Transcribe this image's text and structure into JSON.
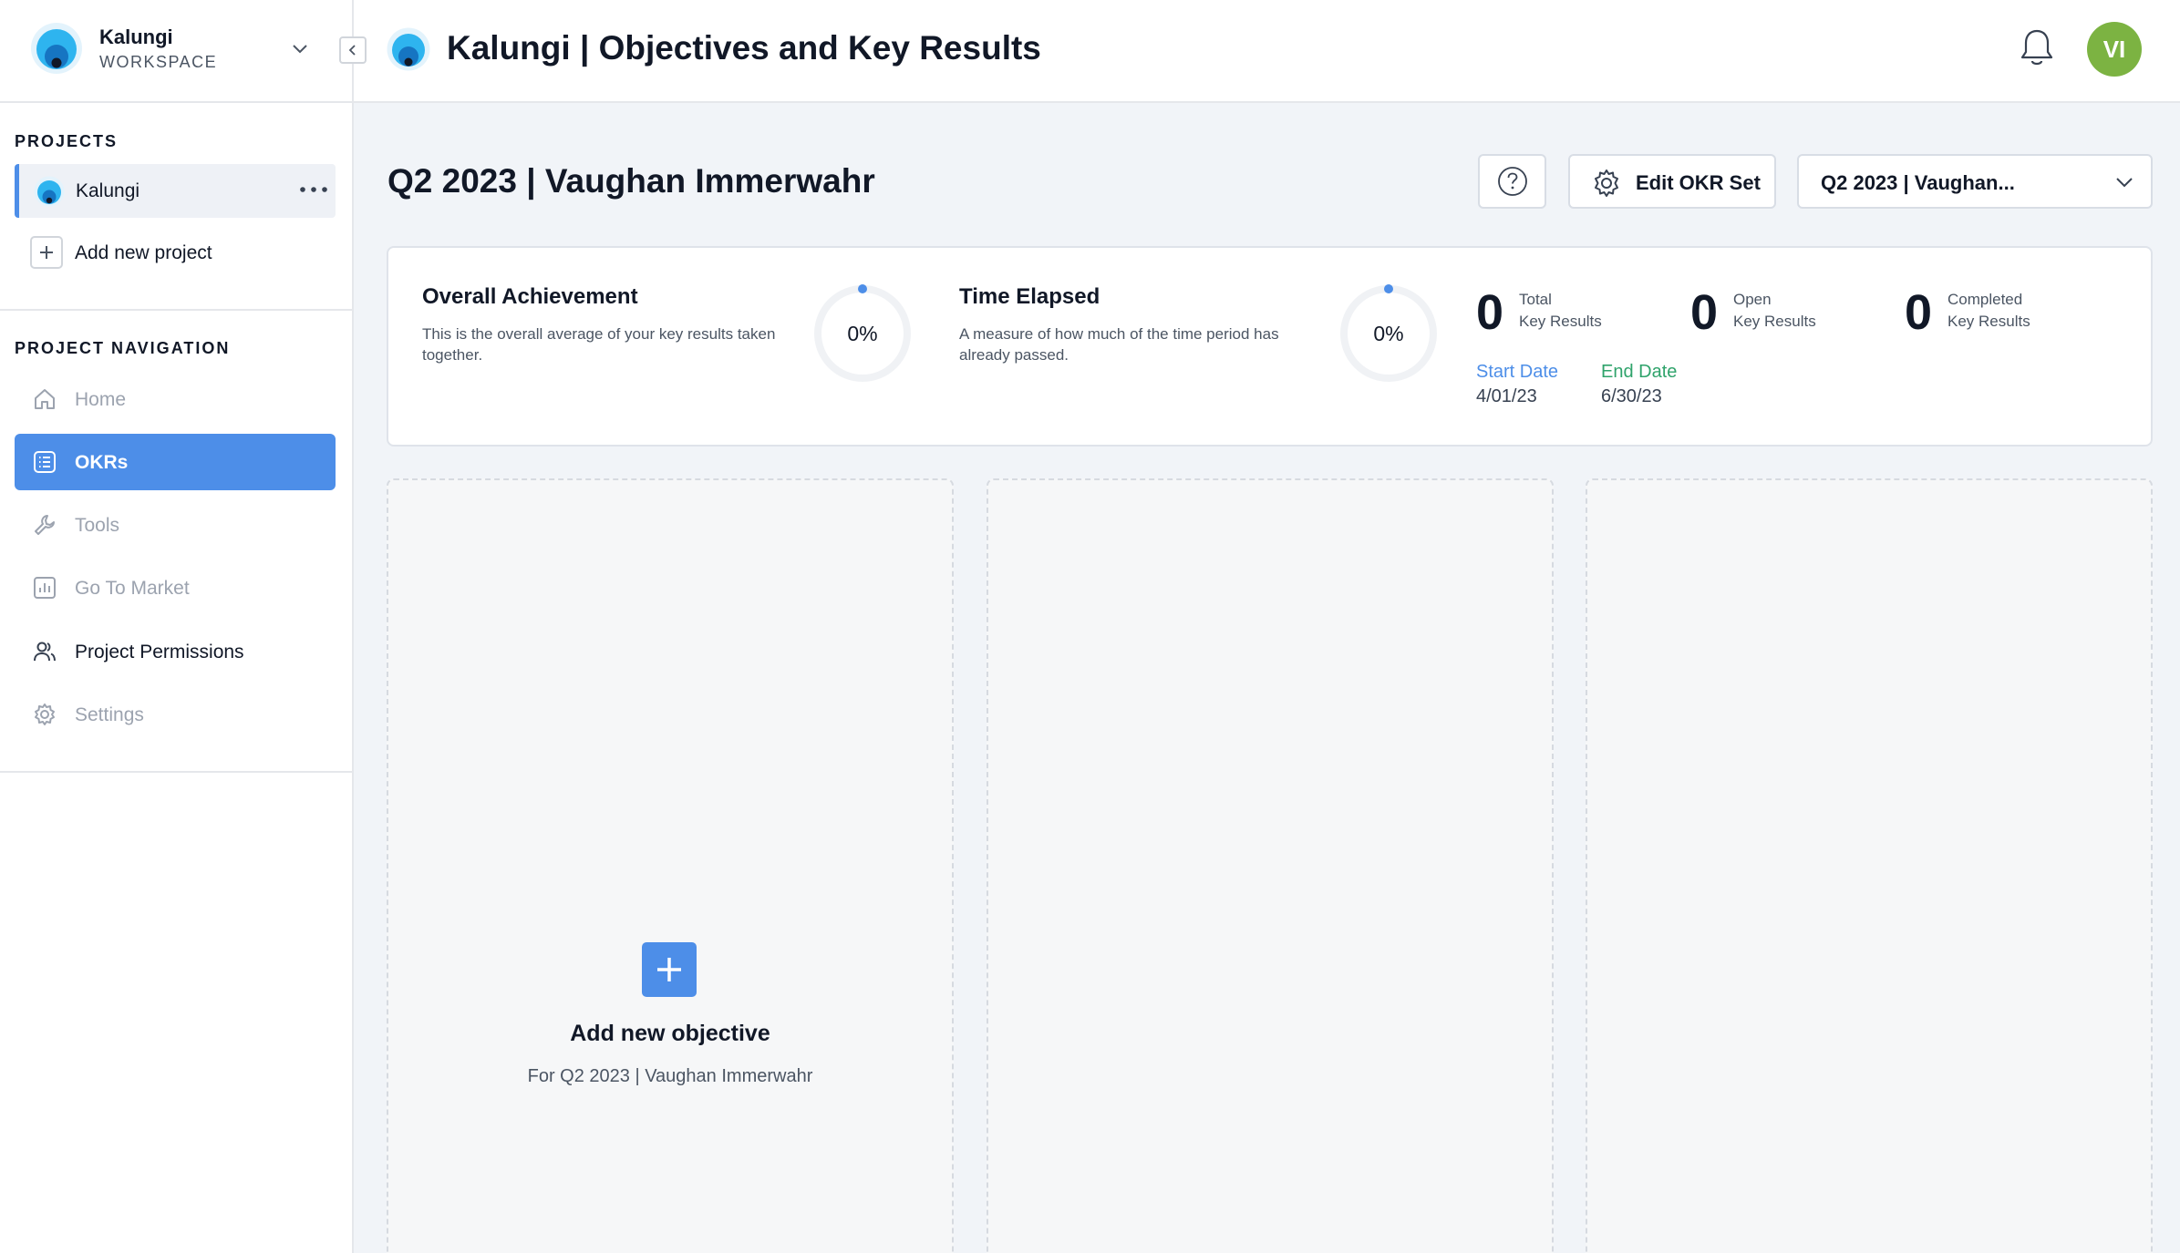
{
  "workspace": {
    "name": "Kalungi",
    "subtitle": "WORKSPACE"
  },
  "sidebar": {
    "projects_title": "PROJECTS",
    "project": {
      "label": "Kalungi"
    },
    "add_project_label": "Add new project",
    "navigation_title": "PROJECT NAVIGATION",
    "nav": [
      {
        "label": "Home",
        "icon": "home-icon",
        "state": "disabled"
      },
      {
        "label": "OKRs",
        "icon": "list-icon",
        "state": "active"
      },
      {
        "label": "Tools",
        "icon": "wrench-icon",
        "state": "disabled"
      },
      {
        "label": "Go To Market",
        "icon": "bar-chart-icon",
        "state": "disabled"
      },
      {
        "label": "Project Permissions",
        "icon": "users-icon",
        "state": "enabled"
      },
      {
        "label": "Settings",
        "icon": "gear-icon",
        "state": "disabled"
      }
    ]
  },
  "header": {
    "title": "Kalungi | Objectives and Key Results",
    "avatar_initials": "VI"
  },
  "okr": {
    "heading": "Q2 2023 | Vaughan Immerwahr",
    "edit_button": "Edit OKR Set",
    "set_select": "Q2 2023 | Vaughan...",
    "overall": {
      "title": "Overall Achievement",
      "desc": "This is the overall average of your key results taken together.",
      "value": "0%",
      "progress": 0
    },
    "elapsed": {
      "title": "Time Elapsed",
      "desc": "A measure of how much of the time period has already passed.",
      "value": "0%",
      "progress": 0
    },
    "counts": [
      {
        "num": "0",
        "line1": "Total",
        "line2": "Key Results"
      },
      {
        "num": "0",
        "line1": "Open",
        "line2": "Key Results"
      },
      {
        "num": "0",
        "line1": "Completed",
        "line2": "Key Results"
      }
    ],
    "start_label": "Start Date",
    "start_value": "4/01/23",
    "end_label": "End Date",
    "end_value": "6/30/23",
    "add_objective": {
      "title": "Add new objective",
      "subtitle": "For Q2 2023 | Vaughan Immerwahr"
    }
  },
  "colors": {
    "accent": "#4d8ee8",
    "start_date": "#4d8ee8",
    "end_date": "#2fa36b",
    "avatar": "#7cb342"
  }
}
